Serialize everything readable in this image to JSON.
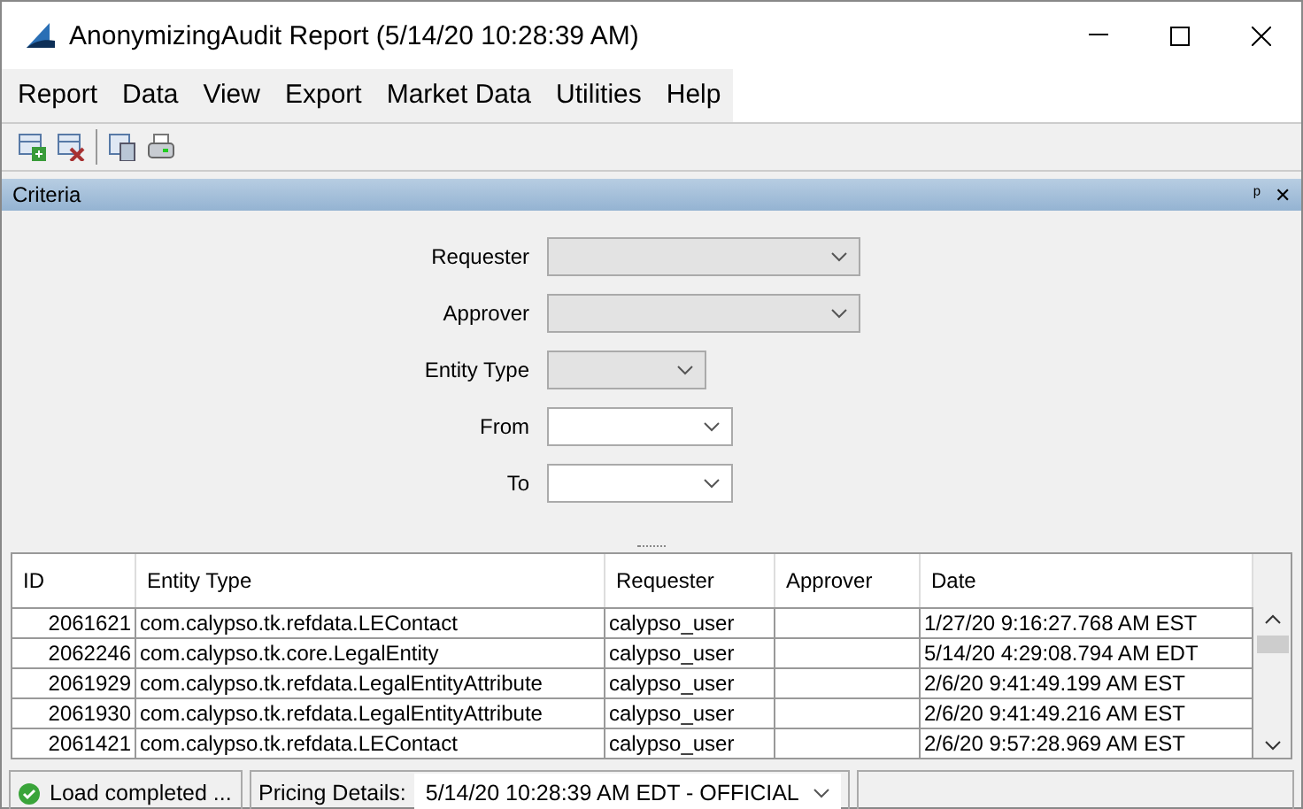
{
  "window": {
    "title": "AnonymizingAudit Report (5/14/20 10:28:39 AM)"
  },
  "menu": [
    "Report",
    "Data",
    "View",
    "Export",
    "Market Data",
    "Utilities",
    "Help"
  ],
  "toolbar": [
    {
      "kind": "add-table"
    },
    {
      "kind": "delete-table"
    },
    {
      "kind": "separator"
    },
    {
      "kind": "calc-table"
    },
    {
      "kind": "print"
    }
  ],
  "criteria": {
    "title": "Criteria",
    "pin": "ᵖ",
    "close": "✕",
    "fields": [
      {
        "label": "Requester",
        "disabled": true
      },
      {
        "label": "Approver",
        "disabled": true
      },
      {
        "label": "Entity Type",
        "disabled": true
      },
      {
        "label": "From",
        "disabled": false
      },
      {
        "label": "To",
        "disabled": false
      }
    ]
  },
  "table": {
    "columns": [
      "ID",
      "Entity Type",
      "Requester",
      "Approver",
      "Date"
    ],
    "rows": [
      [
        "2061621",
        "com.calypso.tk.refdata.LEContact",
        "calypso_user",
        "",
        "1/27/20 9:16:27.768 AM EST"
      ],
      [
        "2062246",
        "com.calypso.tk.core.LegalEntity",
        "calypso_user",
        "",
        "5/14/20 4:29:08.794 AM EDT"
      ],
      [
        "2061929",
        "com.calypso.tk.refdata.LegalEntityAttribute",
        "calypso_user",
        "",
        "2/6/20 9:41:49.199 AM EST"
      ],
      [
        "2061930",
        "com.calypso.tk.refdata.LegalEntityAttribute",
        "calypso_user",
        "",
        "2/6/20 9:41:49.216 AM EST"
      ],
      [
        "2061421",
        "com.calypso.tk.refdata.LEContact",
        "calypso_user",
        "",
        "2/6/20 9:57:28.969 AM EST"
      ]
    ]
  },
  "status_bar": {
    "message": "Load completed ...",
    "pricing_label": "Pricing Details:",
    "pricing_value": "5/14/20 10:28:39 AM EDT - OFFICIAL"
  }
}
